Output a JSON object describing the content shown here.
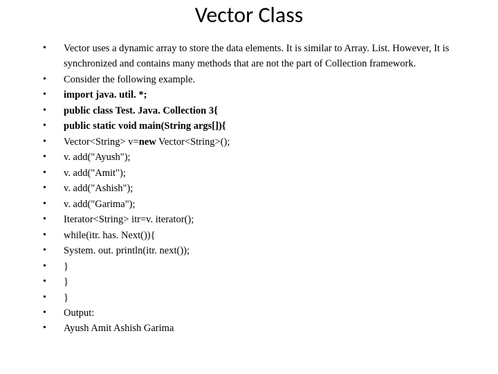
{
  "title": "Vector Class",
  "items": [
    {
      "text": "Vector uses a dynamic array to store the data elements. It is similar to Array. List. However, It is synchronized and contains many methods that are not the part of Collection framework.",
      "bold": false
    },
    {
      "text": "Consider the following example.",
      "bold": false
    },
    {
      "text": "import java. util. *;",
      "bold": true
    },
    {
      "text": "public class Test. Java. Collection 3{",
      "bold": true
    },
    {
      "text": "public static void main(String args[]){",
      "bold": true
    },
    {
      "text": "Vector<String> v=new Vector<String>();",
      "bold": false,
      "leadBold": "new"
    },
    {
      "text": "v. add(\"Ayush\");",
      "bold": false
    },
    {
      "text": "v. add(\"Amit\");",
      "bold": false
    },
    {
      "text": "v. add(\"Ashish\");",
      "bold": false
    },
    {
      "text": "v. add(\"Garima\");",
      "bold": false
    },
    {
      "text": "Iterator<String> itr=v. iterator();",
      "bold": false
    },
    {
      "text": "while(itr. has. Next()){",
      "bold": false
    },
    {
      "text": "System. out. println(itr. next());",
      "bold": false
    },
    {
      "text": "}",
      "bold": false
    },
    {
      "text": "}",
      "bold": false
    },
    {
      "text": "}",
      "bold": false
    },
    {
      "text": "Output:",
      "bold": false
    },
    {
      "text": "Ayush  Amit  Ashish  Garima",
      "bold": false
    }
  ]
}
